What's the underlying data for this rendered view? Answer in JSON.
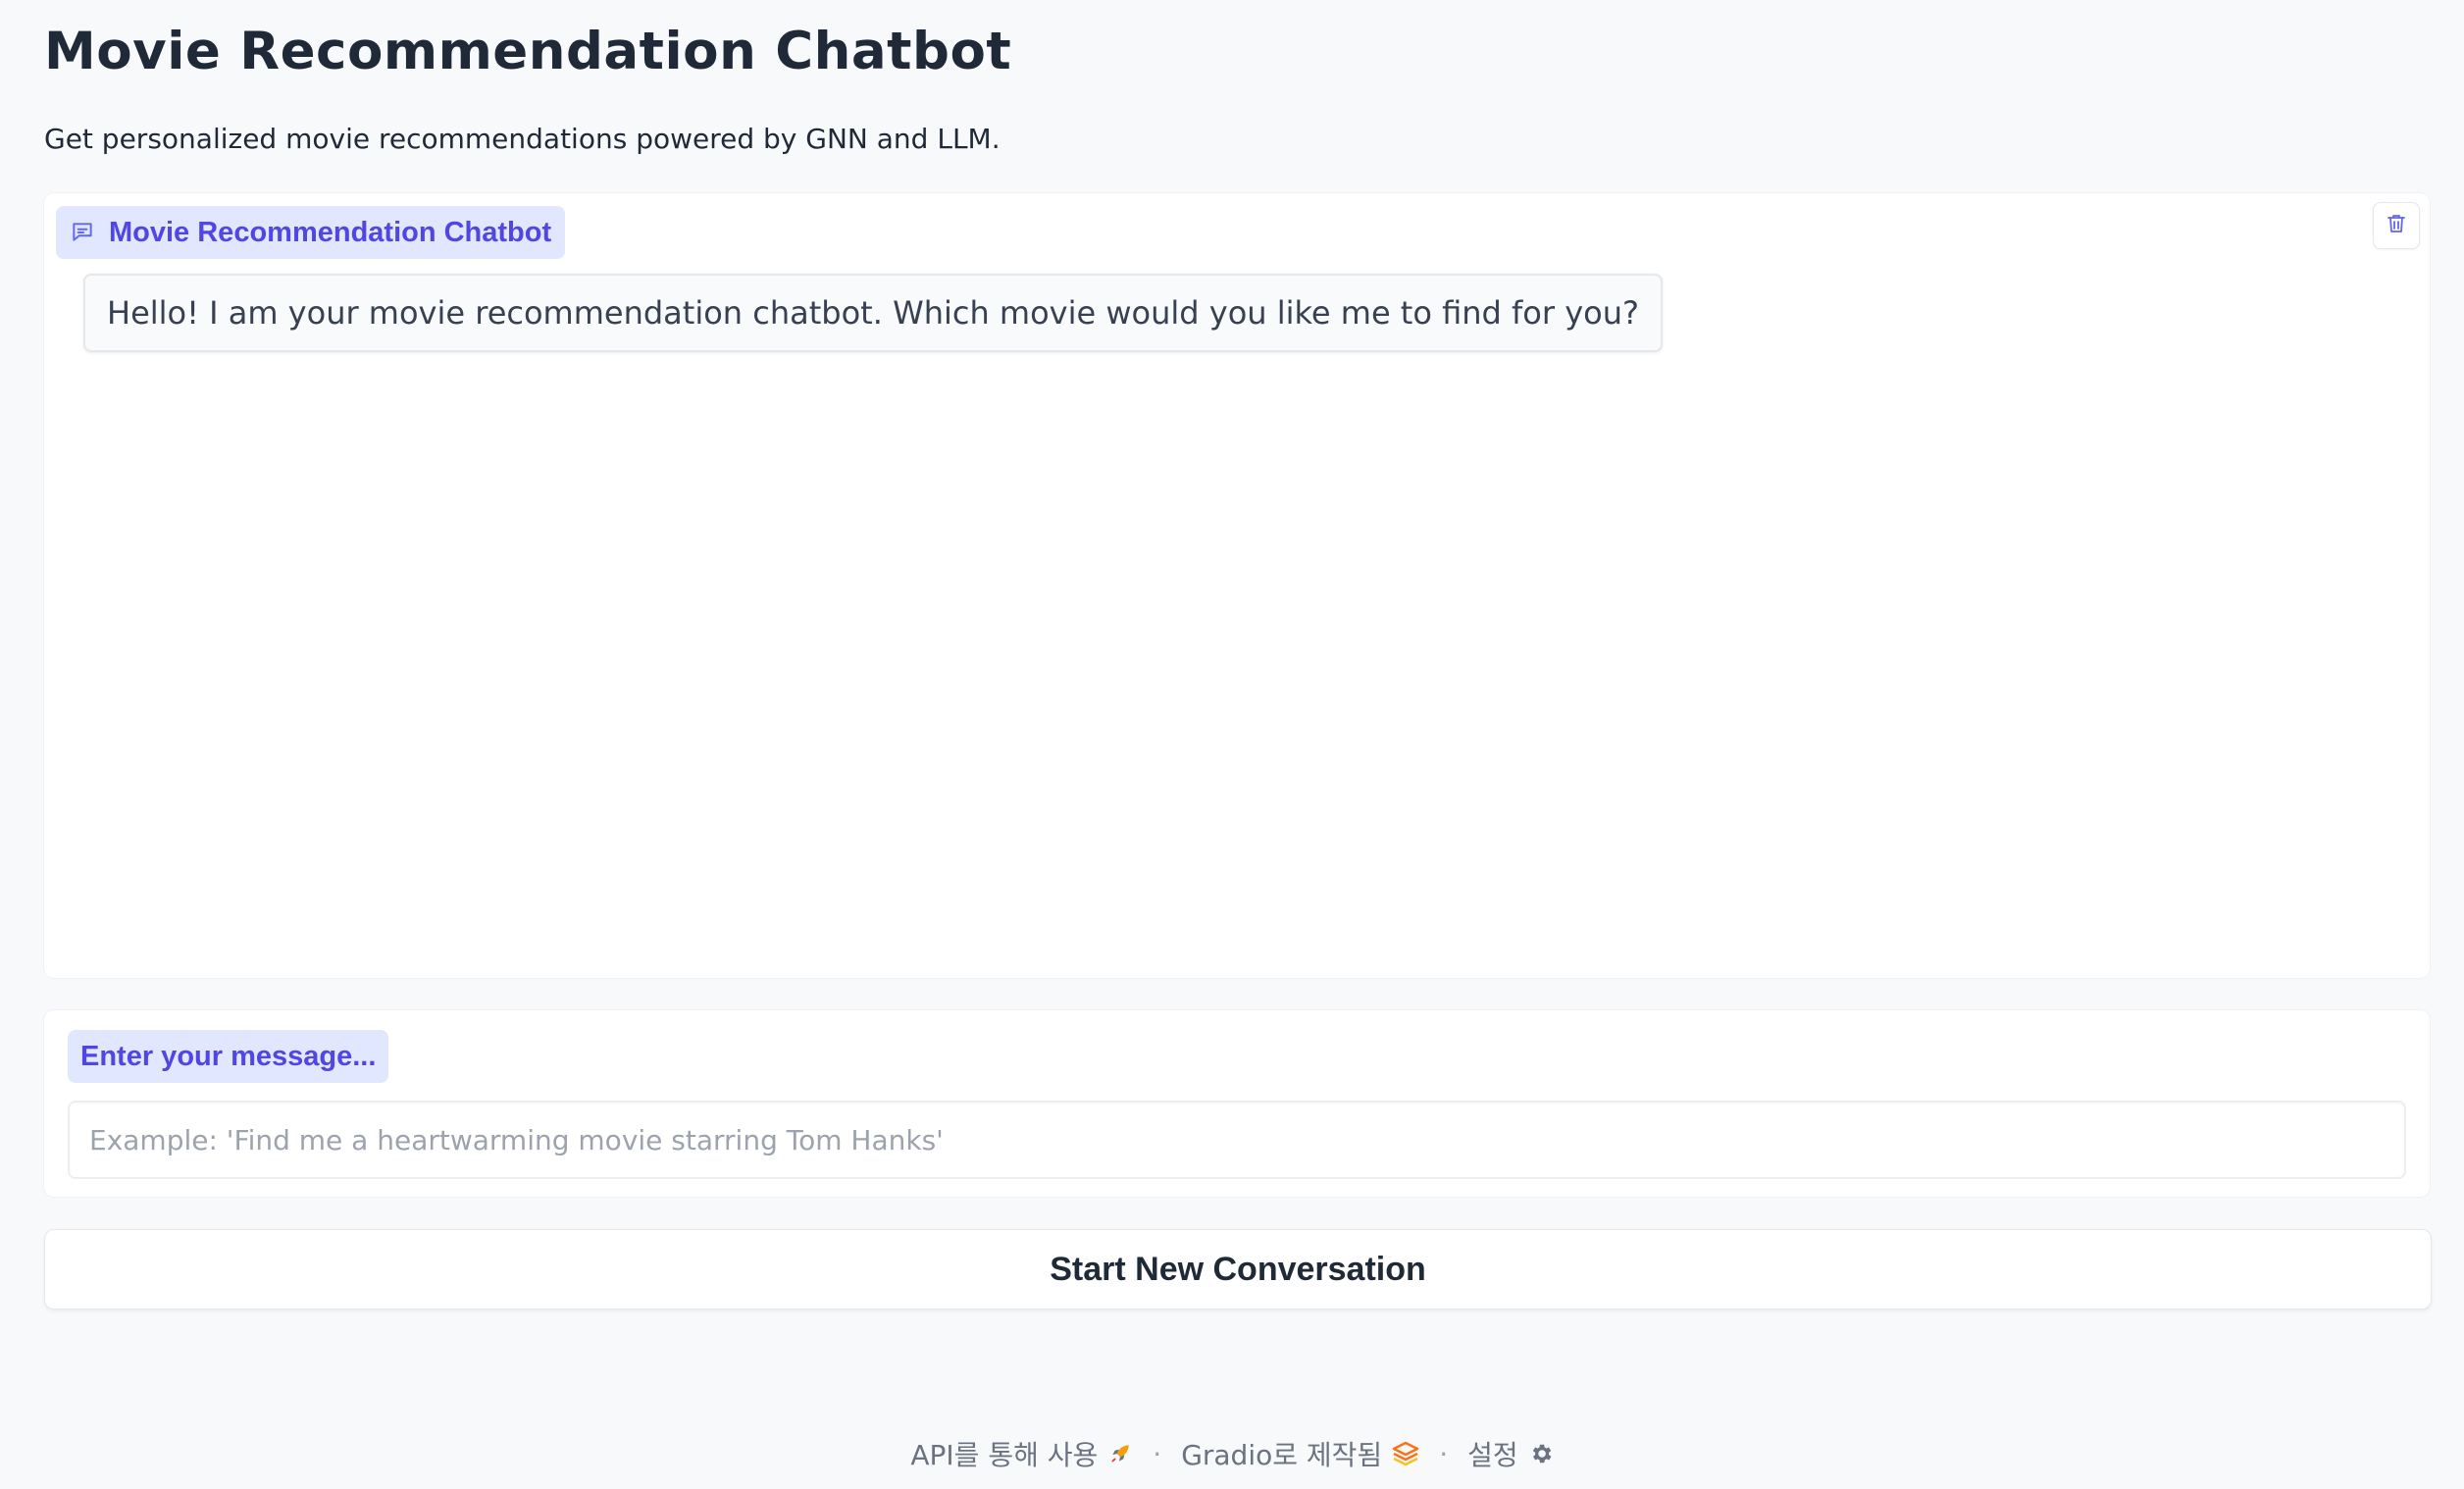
{
  "header": {
    "title": "Movie Recommendation Chatbot",
    "subtitle": "Get personalized movie recommendations powered by GNN and LLM."
  },
  "chatbot": {
    "label": "Movie Recommendation Chatbot",
    "label_icon": "chat-icon",
    "clear_icon": "trash-icon",
    "messages": [
      {
        "role": "bot",
        "text": "Hello! I am your movie recommendation chatbot. Which movie would you like me to find for you?"
      }
    ]
  },
  "input": {
    "label": "Enter your message...",
    "placeholder": "Example: 'Find me a heartwarming movie starring Tom Hanks'",
    "value": ""
  },
  "actions": {
    "new_conversation_label": "Start New Conversation"
  },
  "footer": {
    "api_label": "API를 통해 사용",
    "api_icon": "rocket-icon",
    "built_with_label": "Gradio로 제작됨",
    "built_with_icon": "gradio-logo-icon",
    "settings_label": "설정",
    "settings_icon": "gear-icon",
    "separator": "·"
  },
  "colors": {
    "accent": "#4f46e5",
    "label_background": "#e0e7ff",
    "page_background": "#f8f9fb"
  }
}
